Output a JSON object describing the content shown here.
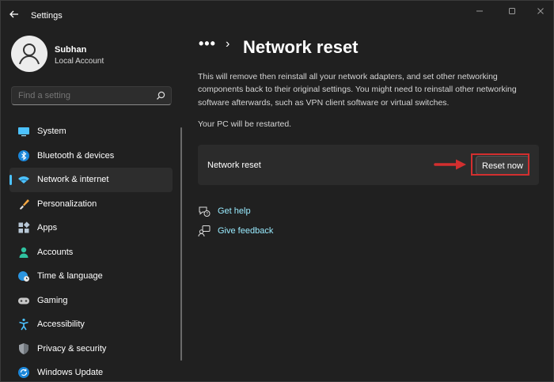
{
  "window": {
    "title": "Settings"
  },
  "profile": {
    "name": "Subhan",
    "account_type": "Local Account"
  },
  "search": {
    "placeholder": "Find a setting"
  },
  "sidebar": {
    "items": [
      {
        "label": "System",
        "icon": "monitor-icon",
        "active": false
      },
      {
        "label": "Bluetooth & devices",
        "icon": "bluetooth-icon",
        "active": false
      },
      {
        "label": "Network & internet",
        "icon": "wifi-icon",
        "active": true
      },
      {
        "label": "Personalization",
        "icon": "brush-icon",
        "active": false
      },
      {
        "label": "Apps",
        "icon": "apps-icon",
        "active": false
      },
      {
        "label": "Accounts",
        "icon": "person-icon",
        "active": false
      },
      {
        "label": "Time & language",
        "icon": "globe-clock-icon",
        "active": false
      },
      {
        "label": "Gaming",
        "icon": "gamepad-icon",
        "active": false
      },
      {
        "label": "Accessibility",
        "icon": "accessibility-icon",
        "active": false
      },
      {
        "label": "Privacy & security",
        "icon": "shield-icon",
        "active": false
      },
      {
        "label": "Windows Update",
        "icon": "update-icon",
        "active": false
      }
    ]
  },
  "breadcrumb": {
    "dots": "•••",
    "separator": "›",
    "title": "Network reset"
  },
  "content": {
    "description": "This will remove then reinstall all your network adapters, and set other networking components back to their original settings. You might need to reinstall other networking software afterwards, such as VPN client software or virtual switches.",
    "restart_note": "Your PC will be restarted.",
    "card_label": "Network reset",
    "reset_button": "Reset now"
  },
  "links": {
    "get_help": "Get help",
    "give_feedback": "Give feedback"
  },
  "colors": {
    "accent": "#4cc2ff",
    "link": "#99ebff",
    "highlight": "#d32f2f",
    "background": "#202020"
  }
}
